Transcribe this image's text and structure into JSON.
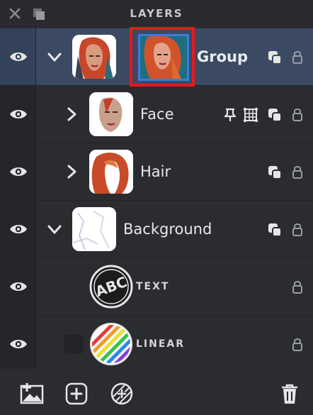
{
  "panel": {
    "title": "LAYERS"
  },
  "layers": [
    {
      "name": "Group",
      "expanded": true,
      "selected": true
    },
    {
      "name": "Face",
      "expanded": false
    },
    {
      "name": "Hair",
      "expanded": false
    },
    {
      "name": "Background",
      "expanded": true
    },
    {
      "name": "TEXT"
    },
    {
      "name": "LINEAR"
    }
  ],
  "colors": {
    "selected_row": "#3b4a62",
    "highlight": "#e8181b",
    "mask_border": "#3a7be0"
  }
}
